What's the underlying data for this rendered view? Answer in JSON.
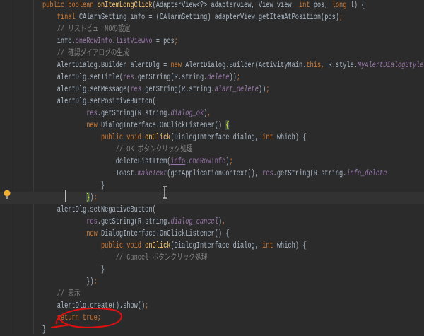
{
  "editor": {
    "current_line": 16,
    "annotation_color": "#e01010",
    "lines": [
      {
        "indent": 0,
        "tokens": [
          [
            "kw",
            "public boolean "
          ],
          [
            "fn",
            "onItemLongClick"
          ],
          [
            "tx",
            "(AdapterView<?> adapterView, View view, "
          ],
          [
            "kw",
            "int "
          ],
          [
            "tx",
            "pos, "
          ],
          [
            "kw",
            "long "
          ],
          [
            "tx",
            "l) {"
          ]
        ]
      },
      {
        "indent": 4,
        "tokens": [
          [
            "kw",
            "final "
          ],
          [
            "tx",
            "CAlarmSetting info = (CAlarmSetting) adapterView.getItemAtPosition(pos)"
          ],
          [
            "kw",
            ";"
          ]
        ]
      },
      {
        "indent": 4,
        "tokens": [
          [
            "cm",
            "// リストビューNOの設定"
          ]
        ]
      },
      {
        "indent": 4,
        "tokens": [
          [
            "tx",
            "info."
          ],
          [
            "fld",
            "oneRowInfo"
          ],
          [
            "tx",
            "."
          ],
          [
            "fld",
            "listViewNo"
          ],
          [
            "tx",
            " = pos"
          ],
          [
            "kw",
            ";"
          ]
        ]
      },
      {
        "indent": 4,
        "tokens": [
          [
            "cm",
            "// 確認ダイアログの生成"
          ]
        ]
      },
      {
        "indent": 4,
        "tokens": [
          [
            "tx",
            "AlertDialog.Builder alertDlg = "
          ],
          [
            "kw",
            "new "
          ],
          [
            "tx",
            "AlertDialog.Builder(ActivityMain."
          ],
          [
            "kw",
            "this, "
          ],
          [
            "tx",
            "R.style."
          ],
          [
            "st",
            "MyAlertDialogStyle"
          ]
        ]
      },
      {
        "indent": 4,
        "tokens": [
          [
            "tx",
            "alertDlg.setTitle("
          ],
          [
            "fld",
            "res"
          ],
          [
            "tx",
            ".getString(R.string."
          ],
          [
            "st",
            "delete"
          ],
          [
            "tx",
            "))"
          ],
          [
            "kw",
            ";"
          ]
        ]
      },
      {
        "indent": 4,
        "tokens": [
          [
            "tx",
            "alertDlg.setMessage("
          ],
          [
            "fld",
            "res"
          ],
          [
            "tx",
            ".getString(R.string."
          ],
          [
            "st",
            "alart_delete"
          ],
          [
            "tx",
            "))"
          ],
          [
            "kw",
            ";"
          ]
        ]
      },
      {
        "indent": 4,
        "tokens": [
          [
            "tx",
            "alertDlg.setPositiveButton("
          ]
        ]
      },
      {
        "indent": 12,
        "tokens": [
          [
            "fld",
            "res"
          ],
          [
            "tx",
            ".getString(R.string."
          ],
          [
            "st",
            "dialog_ok"
          ],
          [
            "tx",
            ")"
          ],
          [
            "kw",
            ","
          ]
        ]
      },
      {
        "indent": 12,
        "tokens": [
          [
            "kw",
            "new "
          ],
          [
            "tx",
            "DialogInterface.OnClickListener() "
          ],
          [
            "hl",
            "{"
          ]
        ]
      },
      {
        "indent": 16,
        "tokens": [
          [
            "kw",
            "public void "
          ],
          [
            "fn",
            "onClick"
          ],
          [
            "tx",
            "(DialogInterface dialog, "
          ],
          [
            "kw",
            "int "
          ],
          [
            "tx",
            "which) {"
          ]
        ]
      },
      {
        "indent": 20,
        "tokens": [
          [
            "cm",
            "// OK ボタンクリック処理"
          ]
        ]
      },
      {
        "indent": 20,
        "tokens": [
          [
            "tx",
            "deleteListItem("
          ],
          [
            "ul",
            "info"
          ],
          [
            "tx",
            "."
          ],
          [
            "fld",
            "oneRowInfo"
          ],
          [
            "tx",
            ")"
          ],
          [
            "kw",
            ";"
          ]
        ]
      },
      {
        "indent": 20,
        "tokens": [
          [
            "tx",
            "Toast."
          ],
          [
            "st",
            "makeText"
          ],
          [
            "tx",
            "(getApplicationContext(), "
          ],
          [
            "fld",
            "res"
          ],
          [
            "tx",
            ".getString(R.string."
          ],
          [
            "st",
            "info_delete"
          ]
        ]
      },
      {
        "indent": 16,
        "tokens": [
          [
            "tx",
            "}"
          ]
        ]
      },
      {
        "indent": 12,
        "tokens": [
          [
            "hl",
            "}"
          ],
          [
            "tx",
            ")"
          ],
          [
            "kw",
            ";"
          ]
        ]
      },
      {
        "indent": 4,
        "tokens": [
          [
            "tx",
            "alertDlg.setNegativeButton("
          ]
        ]
      },
      {
        "indent": 12,
        "tokens": [
          [
            "fld",
            "res"
          ],
          [
            "tx",
            ".getString(R.string."
          ],
          [
            "st",
            "dialog_cancel"
          ],
          [
            "tx",
            ")"
          ],
          [
            "kw",
            ","
          ]
        ]
      },
      {
        "indent": 12,
        "tokens": [
          [
            "kw",
            "new "
          ],
          [
            "tx",
            "DialogInterface.OnClickListener() {"
          ]
        ]
      },
      {
        "indent": 16,
        "tokens": [
          [
            "kw",
            "public void "
          ],
          [
            "fn",
            "onClick"
          ],
          [
            "tx",
            "(DialogInterface dialog, "
          ],
          [
            "kw",
            "int "
          ],
          [
            "tx",
            "which) {"
          ]
        ]
      },
      {
        "indent": 20,
        "tokens": [
          [
            "cm",
            "// Cancel ボタンクリック処理"
          ]
        ]
      },
      {
        "indent": 16,
        "tokens": [
          [
            "tx",
            "}"
          ]
        ]
      },
      {
        "indent": 12,
        "tokens": [
          [
            "tx",
            "})"
          ],
          [
            "kw",
            ";"
          ]
        ]
      },
      {
        "indent": 4,
        "tokens": [
          [
            "cm",
            "// 表示"
          ]
        ]
      },
      {
        "indent": 4,
        "tokens": [
          [
            "tx",
            "alertDlg.create().show()"
          ],
          [
            "kw",
            ";"
          ]
        ]
      },
      {
        "indent": 4,
        "tokens": [
          [
            "kw",
            "return true;"
          ]
        ]
      },
      {
        "indent": 0,
        "tokens": [
          [
            "tx",
            "}"
          ]
        ]
      }
    ]
  }
}
